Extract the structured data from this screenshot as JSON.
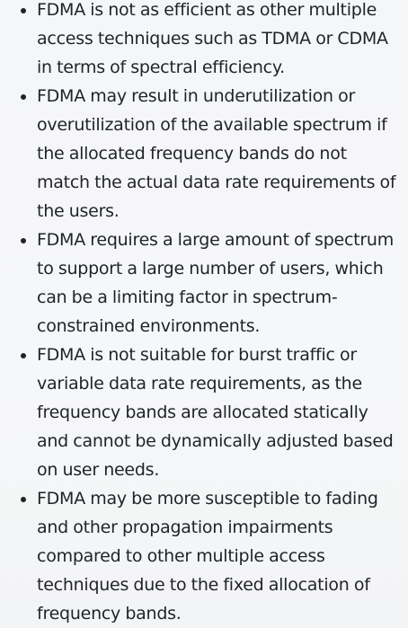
{
  "bullets": [
    {
      "text": "FDMA is not as efficient as other multiple access techniques such as TDMA or CDMA in terms of spectral efficiency."
    },
    {
      "text": "FDMA may result in underutilization or overutilization of the available spectrum if the allocated frequency bands do not match the actual data rate requirements of the users."
    },
    {
      "text": "FDMA requires a large amount of spectrum to support a large number of users, which can be a limiting factor in spectrum-constrained environments."
    },
    {
      "text": "FDMA is not suitable for burst traffic or variable data rate requirements, as the frequency bands are allocated statically and cannot be dynamically adjusted based on user needs."
    },
    {
      "text": "FDMA may be more susceptible to fading and other propagation impairments compared to other multiple access techniques due to the fixed allocation of frequency bands."
    }
  ]
}
